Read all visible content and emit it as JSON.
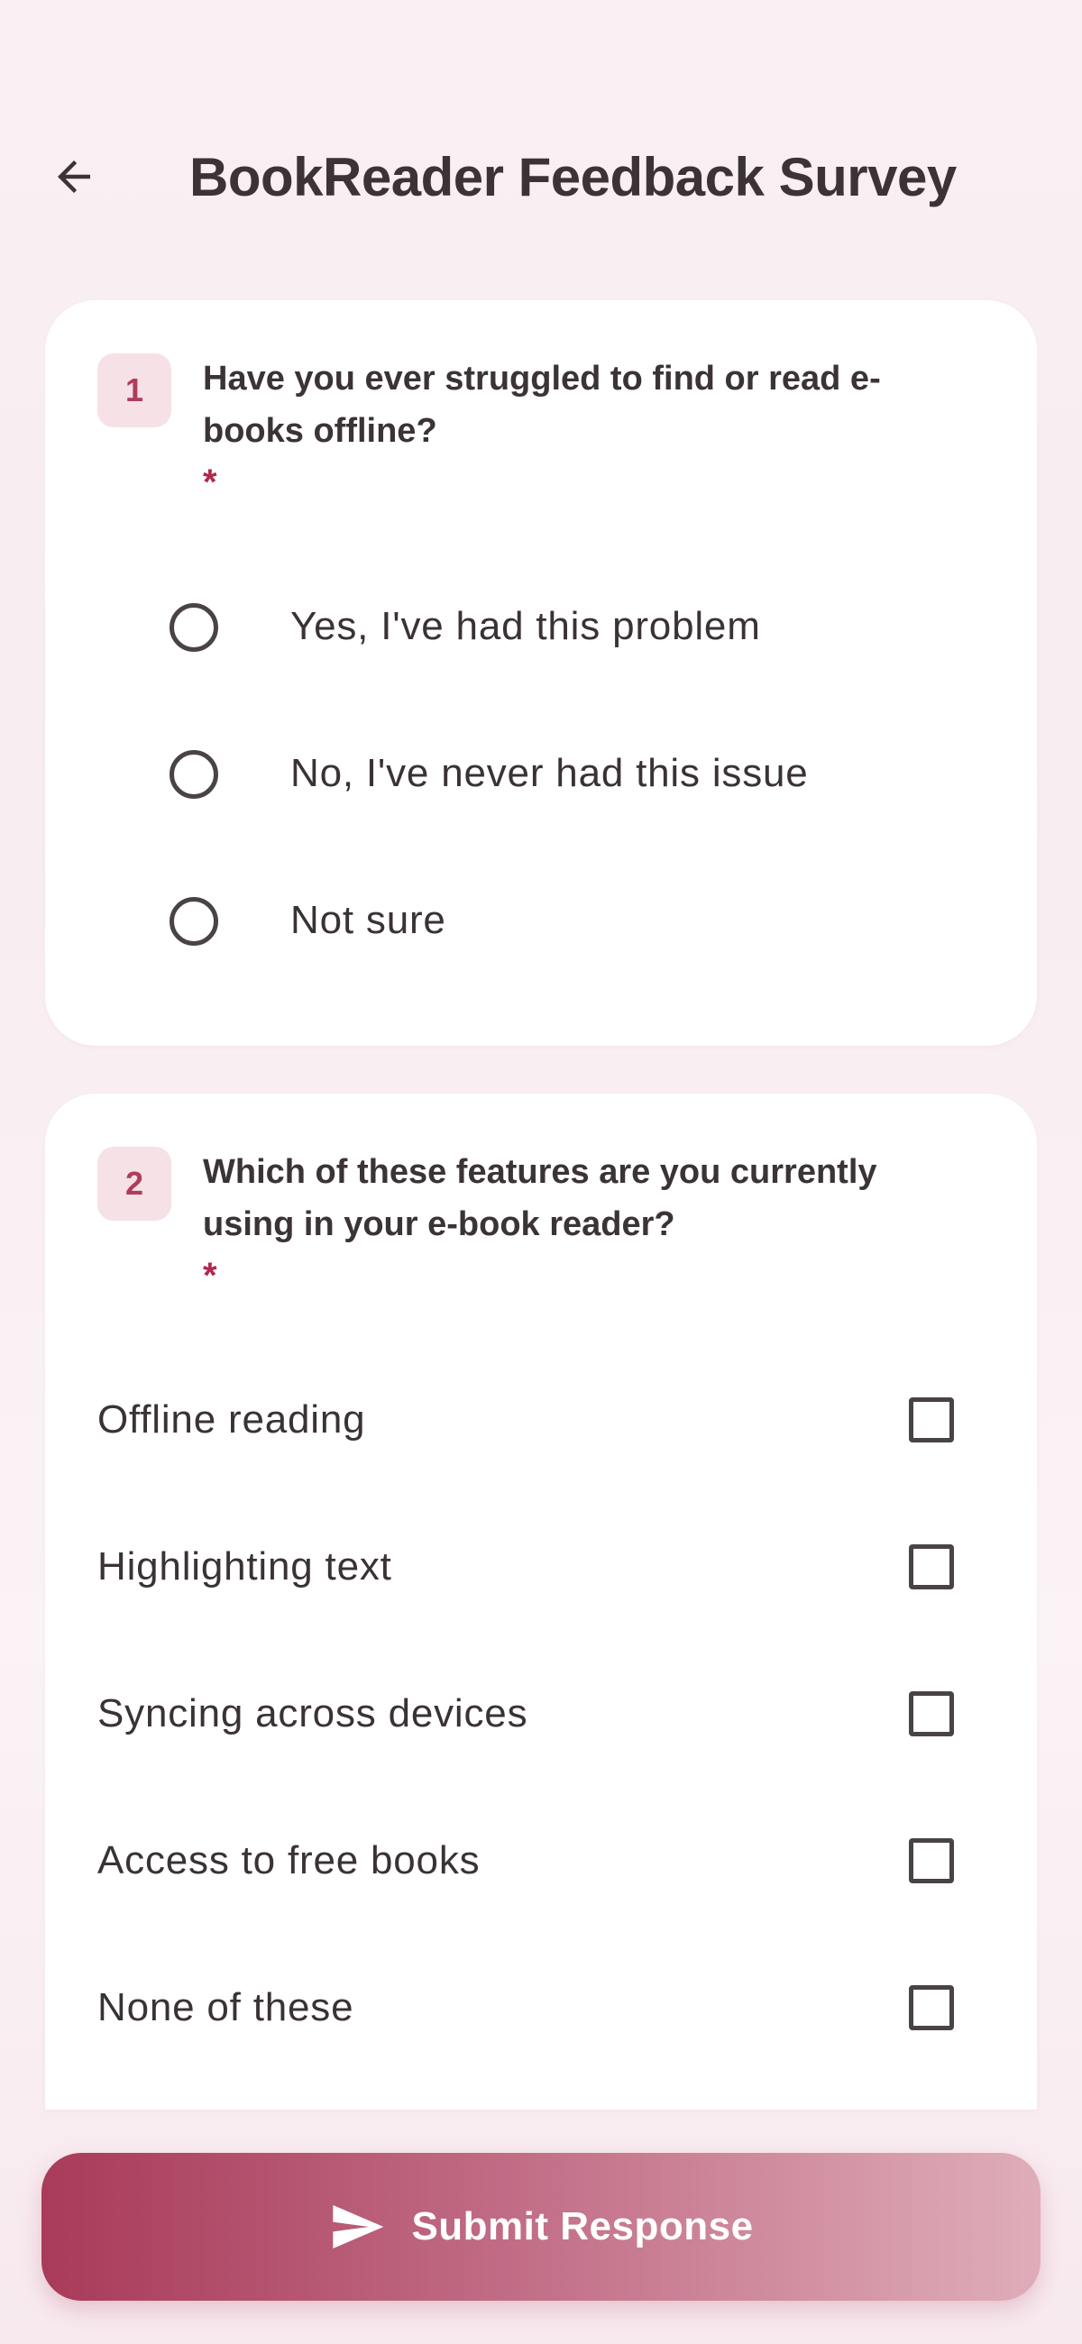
{
  "header": {
    "title": "BookReader Feedback Survey",
    "back_icon": "arrow-left-icon"
  },
  "questions": [
    {
      "number": "1",
      "text": "Have you ever struggled to find or read e-books offline?",
      "required_mark": "*",
      "type": "single-choice",
      "options": [
        {
          "label": "Yes, I've had this problem",
          "selected": false
        },
        {
          "label": "No, I've never had this issue",
          "selected": false
        },
        {
          "label": "Not sure",
          "selected": false
        }
      ]
    },
    {
      "number": "2",
      "text": "Which of these features are you currently using in your e-book reader?",
      "required_mark": "*",
      "type": "multiple-choice",
      "options": [
        {
          "label": "Offline reading",
          "checked": false
        },
        {
          "label": "Highlighting text",
          "checked": false
        },
        {
          "label": "Syncing across devices",
          "checked": false
        },
        {
          "label": "Access to free books",
          "checked": false
        },
        {
          "label": "None of these",
          "checked": false
        }
      ]
    }
  ],
  "submit": {
    "label": "Submit Response",
    "icon": "send-icon"
  },
  "colors": {
    "accent": "#b03c5a",
    "badge_bg": "#f5e1e6",
    "required": "#b0284c",
    "submit_gradient_start": "#a83b59",
    "submit_gradient_end": "#dfadb9"
  }
}
